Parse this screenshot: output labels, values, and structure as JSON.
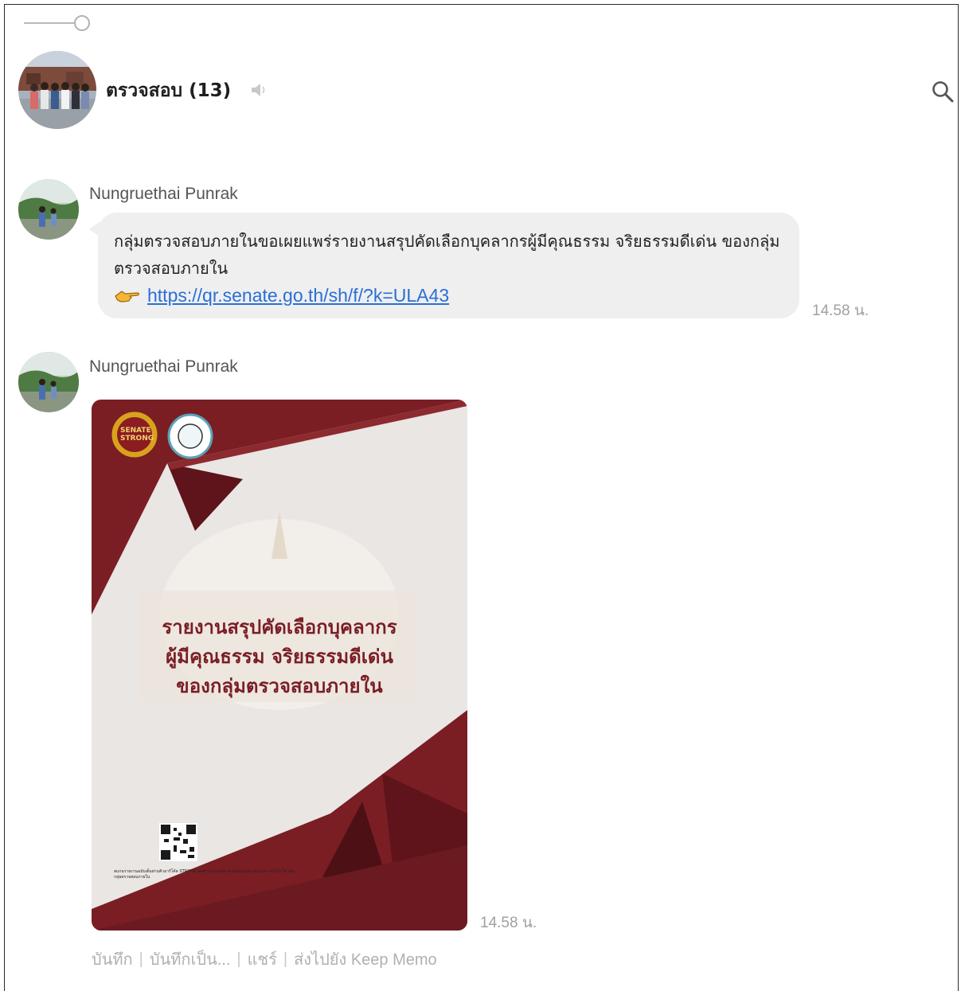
{
  "header": {
    "title": "ตรวจสอบ (13)",
    "icons": {
      "mute": "speaker-muted-icon",
      "search": "search-icon"
    }
  },
  "messages": [
    {
      "sender": "Nungruethai Punrak",
      "text": "กลุ่มตรวจสอบภายในขอเผยแพร่รายงานสรุปคัดเลือกบุคลากรผู้มีคุณธรรม จริยธรรมดีเด่น ของกลุ่มตรวจสอบภายใน",
      "link": "https://qr.senate.go.th/sh/f/?k=ULA43",
      "time": "14.58 น."
    },
    {
      "sender": "Nungruethai Punrak",
      "image": {
        "title_line1": "รายงานสรุปคัดเลือกบุคลากร",
        "title_line2": "ผู้มีคุณธรรม จริยธรรมดีเด่น",
        "title_line3": "ของกลุ่มตรวจสอบภายใน",
        "logo_text": "SENATE STRONG",
        "caption": "สแกนรายงานฉบับเต็มผ่านคิวอาร์โค้ด STRONG ต่อต้านการทุจริต ส่งเสริมคุณธรรมและความโปร่งใส ของกลุ่มตรวจสอบภายใน"
      },
      "time": "14.58 น."
    }
  ],
  "actions": {
    "save": "บันทึก",
    "save_as": "บันทึกเป็น...",
    "share": "แชร์",
    "keep": "ส่งไปยัง Keep Memo"
  },
  "colors": {
    "link": "#2a6fd6",
    "bubble": "#efefef",
    "poster_accent": "#7a1e24"
  }
}
